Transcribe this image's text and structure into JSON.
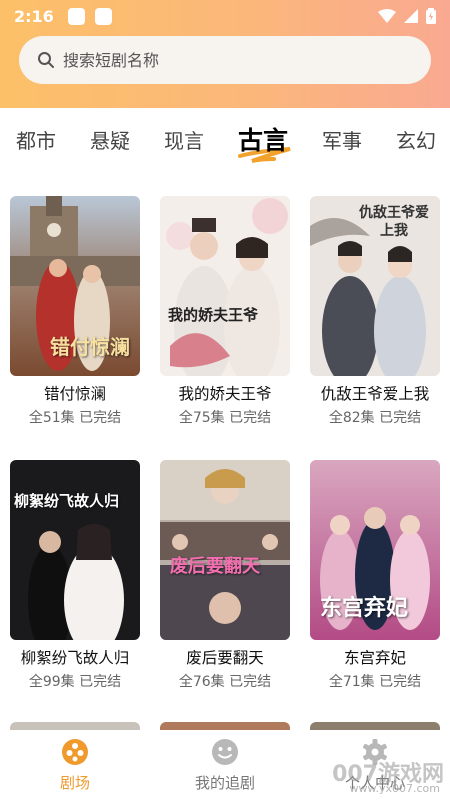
{
  "status_bar": {
    "time": "2:16"
  },
  "search": {
    "placeholder": "搜索短剧名称"
  },
  "tabs": [
    {
      "label": "都市"
    },
    {
      "label": "悬疑"
    },
    {
      "label": "现言"
    },
    {
      "label": "古言",
      "active": true
    },
    {
      "label": "军事"
    },
    {
      "label": "玄幻"
    }
  ],
  "dramas": [
    {
      "title": "错付惊澜",
      "meta": "全51集 已完结",
      "poster_text": "错付惊澜"
    },
    {
      "title": "我的娇夫王爷",
      "meta": "全75集 已完结",
      "poster_text": "我的娇夫王爷"
    },
    {
      "title": "仇敌王爷爱上我",
      "meta": "全82集 已完结",
      "poster_text": "仇敌王爷爱上我"
    },
    {
      "title": "柳絮纷飞故人归",
      "meta": "全99集 已完结",
      "poster_text": "柳絮纷飞故人归"
    },
    {
      "title": "废后要翻天",
      "meta": "全76集 已完结",
      "poster_text": "废后要翻天"
    },
    {
      "title": "东宫弃妃",
      "meta": "全71集 已完结",
      "poster_text": "东宫弃妃"
    }
  ],
  "bottom_nav": [
    {
      "label": "剧场",
      "icon": "theater-icon",
      "active": true
    },
    {
      "label": "我的追剧",
      "icon": "smile-icon"
    },
    {
      "label": "个人中心",
      "icon": "gear-icon"
    }
  ],
  "watermark": {
    "text": "007游戏网",
    "sub": "www.yx007.com"
  },
  "colors": {
    "accent": "#f09a2e",
    "header_start": "#fcc068",
    "header_end": "#f9a991"
  }
}
